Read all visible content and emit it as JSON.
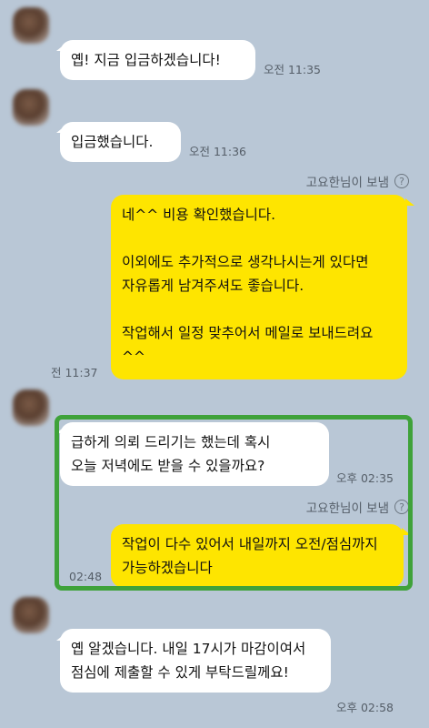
{
  "messages": {
    "m1": {
      "text": "옙! 지금 입금하겠습니다!",
      "time": "오전 11:35"
    },
    "m2": {
      "text": "입금했습니다.",
      "time": "오전 11:36"
    },
    "sender_label": "고요한님이 보냄",
    "m3": {
      "text": "네^^ 비용 확인했습니다.\n\n이외에도 추가적으로 생각나시는게 있다면 자유롭게 남겨주셔도 좋습니다.\n\n작업해서 일정 맞추어서 메일로 보내드려요^^",
      "time": "전 11:37"
    },
    "m4": {
      "text": "급하게 의뢰 드리기는 했는데 혹시\n오늘 저녁에도 받을 수 있을까요?",
      "time": "오후 02:35"
    },
    "m5": {
      "text": "작업이 다수 있어서 내일까지 오전/점심까지 가능하겠습니다",
      "time": "02:48"
    },
    "m6": {
      "text": "옙 알겠습니다. 내일 17시가 마감이여서 점심에 제출할 수 있게 부탁드릴께요!",
      "time": "오후 02:58"
    }
  },
  "icons": {
    "help": "question-circle-icon"
  },
  "colors": {
    "background": "#b9c7d6",
    "sent_bubble": "#fee500",
    "received_bubble": "#ffffff",
    "highlight": "#3fa23a"
  }
}
